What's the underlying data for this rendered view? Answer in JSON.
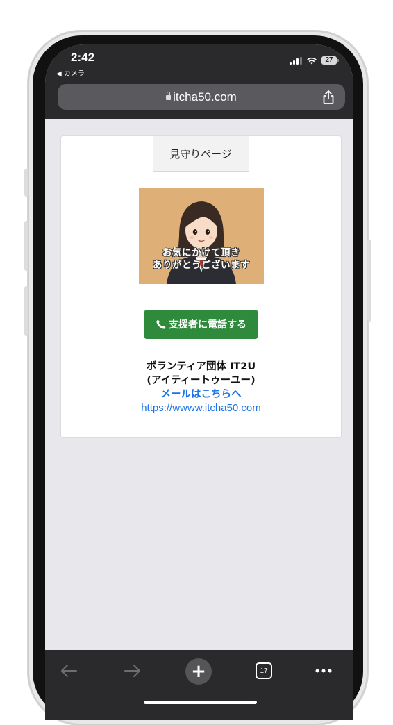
{
  "status_bar": {
    "time": "2:42",
    "back_app": "◀ カメラ",
    "battery": "27"
  },
  "browser": {
    "url": "itcha50.com",
    "tab_count": "17"
  },
  "page": {
    "tab_label": "見守りページ",
    "image_caption_line1": "お気にかけて頂き",
    "image_caption_line2": "ありがとうございます",
    "call_button_label": "支援者に電話する",
    "org_name": "ボランティア団体 IT2U",
    "org_reading": "(アイティートゥーユー)",
    "mail_link": "メールはこちらへ",
    "site_link": "https://wwww.itcha50.com"
  },
  "colors": {
    "call_button": "#2f8a3c",
    "link": "#1a73e8",
    "image_bg": "#deb078"
  },
  "icons": [
    "lock-icon",
    "share-icon",
    "phone-icon",
    "back-arrow-icon",
    "forward-arrow-icon",
    "plus-icon",
    "tabs-icon",
    "more-icon"
  ]
}
